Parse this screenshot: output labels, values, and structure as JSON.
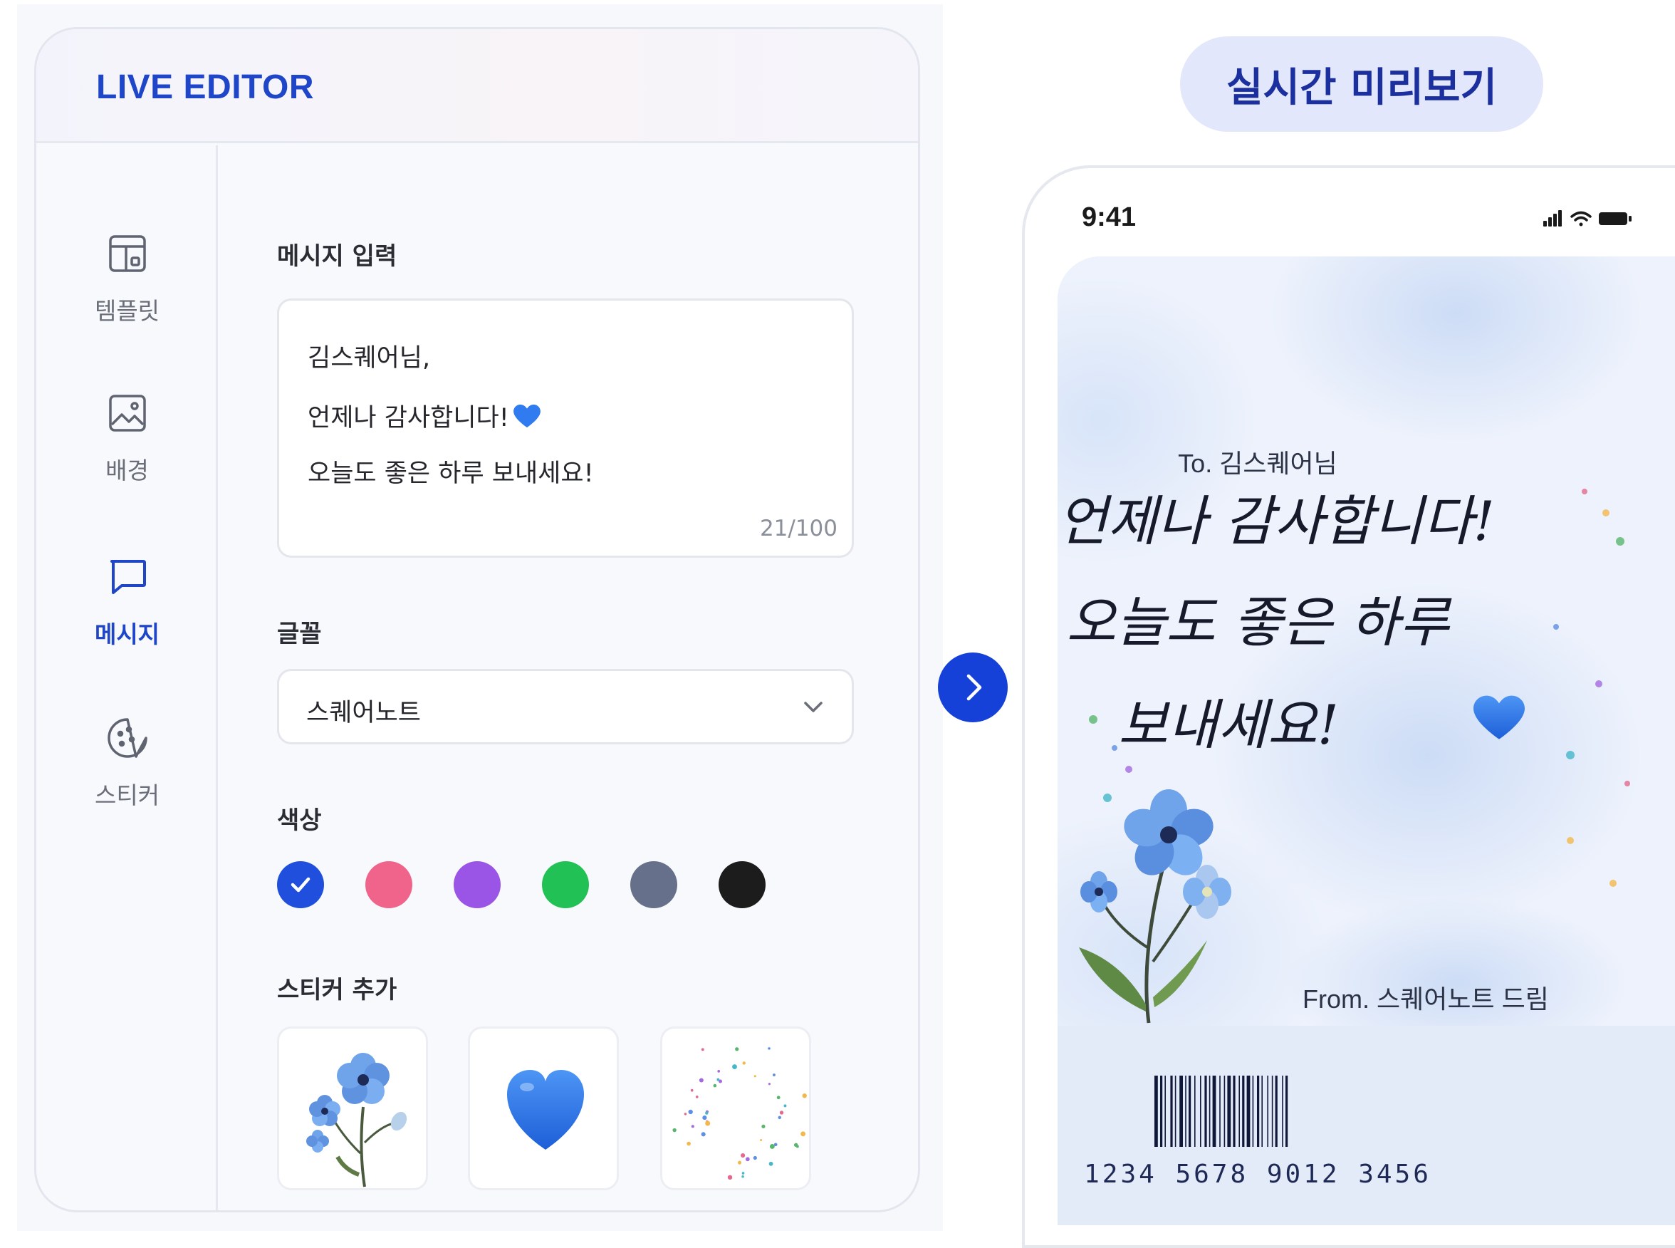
{
  "editor": {
    "title": "LIVE EDITOR",
    "sidebar": [
      {
        "label": "템플릿",
        "icon": "template-icon",
        "active": false
      },
      {
        "label": "배경",
        "icon": "image-icon",
        "active": false
      },
      {
        "label": "메시지",
        "icon": "message-icon",
        "active": true
      },
      {
        "label": "스티커",
        "icon": "sticker-icon",
        "active": false
      }
    ],
    "message": {
      "label": "메시지 입력",
      "lines": [
        "김스퀘어님,",
        "언제나 감사합니다!",
        "오늘도 좋은 하루 보내세요!"
      ],
      "emoji": "blue-heart-icon",
      "count": "21/100"
    },
    "font": {
      "label": "글꼴",
      "selected": "스퀘어노트"
    },
    "color": {
      "label": "색상",
      "swatches": [
        "#1f4fdc",
        "#f0638a",
        "#9a55e6",
        "#22c155",
        "#66708a",
        "#1c1c1c"
      ],
      "selected_index": 0
    },
    "stickers": {
      "label": "스티커 추가",
      "items": [
        "flower-sticker",
        "heart-sticker",
        "confetti-sticker"
      ]
    }
  },
  "preview": {
    "title": "실시간 미리보기",
    "status_time": "9:41",
    "card": {
      "to": "To. 김스퀘어님",
      "message_lines": [
        "언제나 감사합니다!",
        "오늘도 좋은 하루",
        "보내세요!"
      ],
      "from": "From. 스퀘어노트 드림",
      "barcode": "1234 5678 9012 3456"
    }
  },
  "colors": {
    "accent": "#1f45c8",
    "arrow": "#1641d9",
    "pill": "#e3e7fb"
  }
}
